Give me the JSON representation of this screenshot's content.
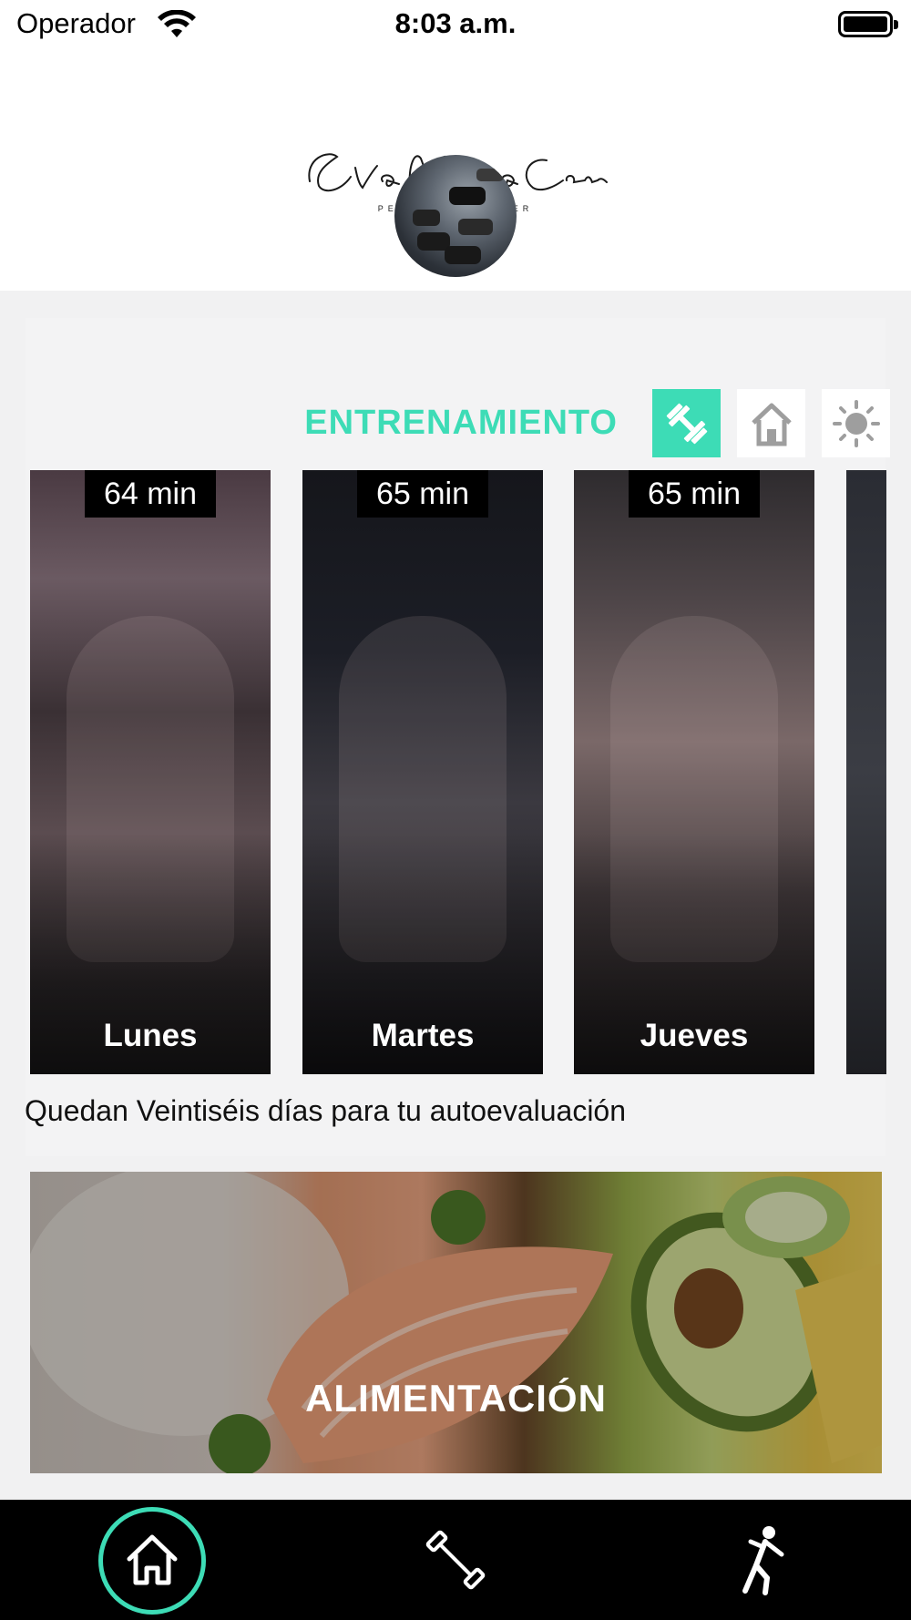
{
  "status_bar": {
    "carrier": "Operador",
    "time": "8:03 a.m.",
    "icons": [
      "wifi-icon",
      "battery-icon"
    ]
  },
  "header": {
    "logo_script": "Eva María Cervera",
    "logo_subtitle": "PERSONAL TRAINER",
    "avatar": "dumbbell-rack-photo"
  },
  "training": {
    "title": "ENTRENAMIENTO",
    "tabs": [
      {
        "icon": "dumbbell-icon",
        "selected": true
      },
      {
        "icon": "house-icon",
        "selected": false
      },
      {
        "icon": "sun-icon",
        "selected": false
      }
    ],
    "cards": [
      {
        "duration": "64 min",
        "day": "Lunes"
      },
      {
        "duration": "65 min",
        "day": "Martes"
      },
      {
        "duration": "65 min",
        "day": "Jueves"
      }
    ]
  },
  "evaluation_notice": "Quedan Veintiséis días para tu autoevaluación",
  "nutrition": {
    "label": "ALIMENTACIÓN"
  },
  "tabbar": {
    "items": [
      {
        "icon": "home-icon",
        "active": true
      },
      {
        "icon": "dumbbell-icon",
        "active": false
      },
      {
        "icon": "stretching-icon",
        "active": false
      }
    ]
  },
  "colors": {
    "accent": "#3ddcb6",
    "background": "#f1f1f2",
    "tabbar": "#000000"
  }
}
